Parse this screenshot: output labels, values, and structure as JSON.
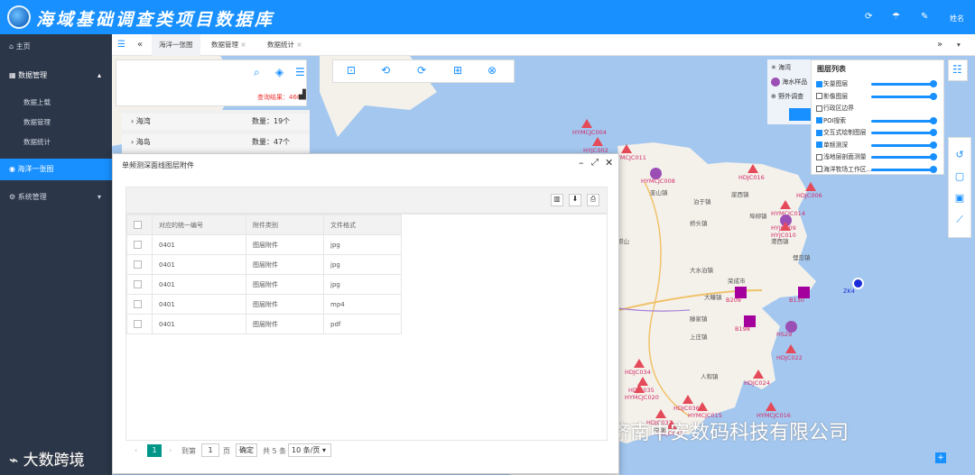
{
  "header": {
    "title": "海域基础调查类项目数据库",
    "user": "姓名"
  },
  "sidebar": {
    "home": "主页",
    "data_mgmt": "数据管理",
    "upload": "数据上载",
    "manage": "数据管理",
    "stats": "数据统计",
    "ocean": "海洋一张图",
    "system": "系统管理"
  },
  "tabs": [
    "海洋一张图",
    "数据管理",
    "数据统计"
  ],
  "query": {
    "result": "查询结果：466",
    "rows": [
      {
        "name": "海湾",
        "count": "数量：19个"
      },
      {
        "name": "海岛",
        "count": "数量：47个"
      }
    ]
  },
  "legend": [
    "海湾",
    "海水样品",
    "野外调查"
  ],
  "layers": {
    "title": "图层列表",
    "items": [
      {
        "label": "矢量图层",
        "on": true,
        "slider": true
      },
      {
        "label": "影像图层",
        "on": false,
        "slider": true
      },
      {
        "label": "行政区边界",
        "on": false,
        "slider": false
      },
      {
        "label": "POI搜索",
        "on": true,
        "slider": true
      },
      {
        "label": "交互式绘制图层",
        "on": true,
        "slider": true
      },
      {
        "label": "单频测深",
        "on": true,
        "slider": true
      },
      {
        "label": "浅地层剖面测量",
        "on": false,
        "slider": true
      },
      {
        "label": "海洋牧场工作区...",
        "on": false,
        "slider": true
      }
    ]
  },
  "dialog": {
    "title": "单频测深面线图层附件",
    "columns": [
      "对应的统一编号",
      "附件类别",
      "文件格式"
    ],
    "rows": [
      [
        "0401",
        "图层附件",
        "jpg"
      ],
      [
        "0401",
        "图层附件",
        "jpg"
      ],
      [
        "0401",
        "图层附件",
        "jpg"
      ],
      [
        "0401",
        "图层附件",
        "mp4"
      ],
      [
        "0401",
        "图层附件",
        "pdf"
      ]
    ],
    "pager": {
      "page": "1",
      "goto": "到第",
      "page_input": "1",
      "page_unit": "页",
      "confirm": "确定",
      "total": "共 5 条",
      "size": "10 条/页"
    }
  },
  "map_labels": [
    "HYMCJC004",
    "HYJC002",
    "HYMCJC011",
    "HYMCJC008",
    "HDJC016",
    "HDJC006",
    "HYMCJC014",
    "HYJC009",
    "HYJC010",
    "B209",
    "B130",
    "ZK4",
    "B198",
    "HS29",
    "HDJC022",
    "HDJC024",
    "HDJC034",
    "HDJC035",
    "HYMCJC020",
    "HDJC036",
    "HYMCJC015",
    "HYMCJC016",
    "HDJC032",
    "HDJC037"
  ],
  "town_labels": [
    "奎山镇",
    "泊于镇",
    "崖西镇",
    "埠柳镇",
    "桥头镇",
    "港西镇",
    "俚岛镇",
    "大水泊镇",
    "荣成市",
    "大疃镇",
    "滕家镇",
    "上庄镇",
    "人和镇",
    "宁津",
    "崂山"
  ],
  "watermark": {
    "company": "济南中安数码科技有限公司",
    "brand": "大数跨境"
  },
  "icons": [
    "home-icon",
    "folder-icon",
    "globe-icon",
    "gear-icon",
    "refresh-icon",
    "skin-icon",
    "message-icon",
    "filter-icon"
  ]
}
